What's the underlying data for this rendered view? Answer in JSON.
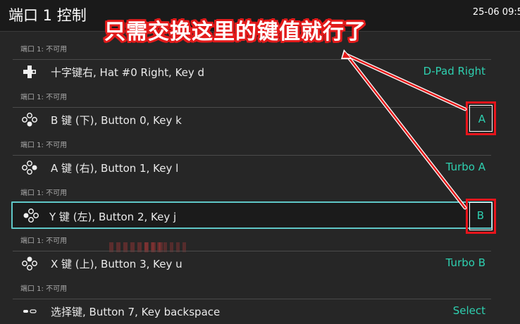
{
  "header": {
    "title": "端口 1 控制",
    "clock": "25-06 09:5"
  },
  "annotation": {
    "callout_text": "只需交换这里的键值就行了",
    "color": "#e31b1b"
  },
  "accent_color": "#2ed0b0",
  "selection_color": "#5fc7c7",
  "rows": [
    {
      "sub": "端口 1: 不可用",
      "icon": "dpad-icon",
      "label": "十字键右, Hat #0 Right, Key d",
      "value": "D-Pad Right"
    },
    {
      "sub": "端口 1: 不可用",
      "icon": "face-buttons-bottom-icon",
      "label": "B 键 (下), Button 0, Key k",
      "value": "A"
    },
    {
      "sub": "端口 1: 不可用",
      "icon": "face-buttons-right-icon",
      "label": "A 键 (右), Button 1, Key l",
      "value": "Turbo A"
    },
    {
      "sub": "端口 1: 不可用",
      "icon": "face-buttons-left-icon",
      "label": "Y 键 (左), Button 2, Key j",
      "value": "B"
    },
    {
      "sub": "端口 1: 不可用",
      "icon": "face-buttons-top-icon",
      "label": "X 键 (上), Button 3, Key u",
      "value": "Turbo B"
    },
    {
      "sub": "端口 1: 不可用",
      "icon": "select-button-icon",
      "label": "选择键, Button 7, Key backspace",
      "value": "Select"
    }
  ]
}
